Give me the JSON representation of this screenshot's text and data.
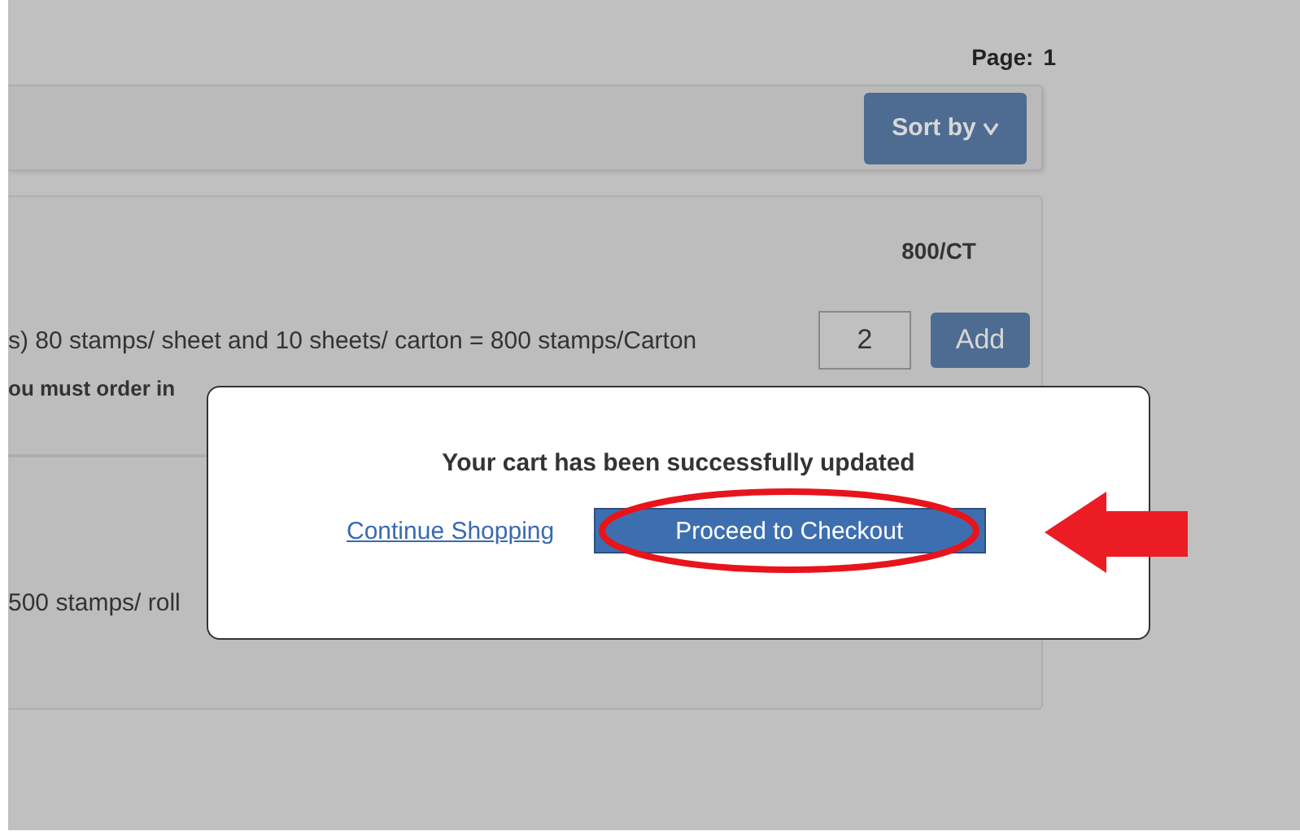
{
  "pager": {
    "label": "Page:",
    "number": "1"
  },
  "toolbar": {
    "sort_button": "Sort by"
  },
  "products": [
    {
      "unit": "800/CT",
      "description": "s) 80 stamps/ sheet and 10 sheets/ carton = 800 stamps/Carton",
      "quantity": "2",
      "add_button": "Add",
      "note": "ou must order in"
    },
    {
      "description": "500 stamps/ roll"
    }
  ],
  "dialog": {
    "message": "Your cart has been successfully updated",
    "link": "Continue Shopping",
    "button": "Proceed to Checkout"
  }
}
